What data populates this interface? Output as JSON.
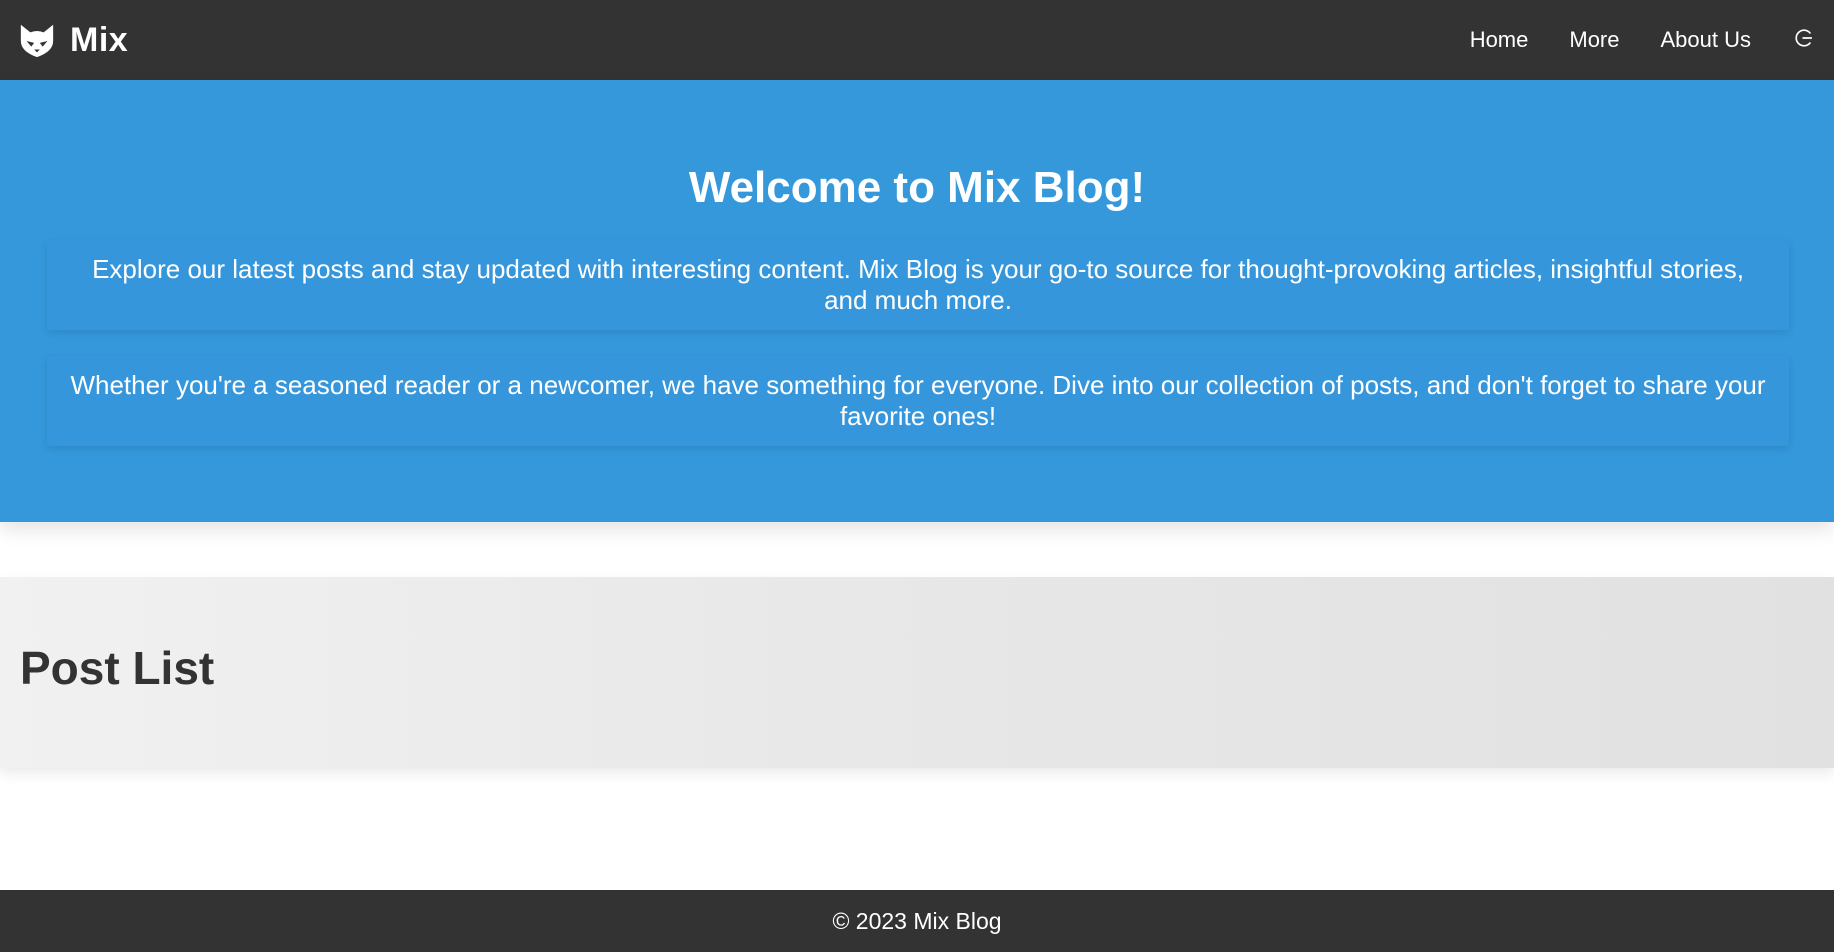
{
  "navbar": {
    "brand_name": "Mix",
    "logo_icon": "fox-icon",
    "links": [
      {
        "label": "Home"
      },
      {
        "label": "More"
      },
      {
        "label": "About Us"
      }
    ],
    "action_icon": "logout-icon"
  },
  "hero": {
    "title": "Welcome to Mix Blog!",
    "paragraphs": [
      "Explore our latest posts and stay updated with interesting content. Mix Blog is your go-to source for thought-provoking articles, insightful stories, and much more.",
      "Whether you're a seasoned reader or a newcomer, we have something for everyone. Dive into our collection of posts, and don't forget to share your favorite ones!"
    ]
  },
  "post_list": {
    "title": "Post List"
  },
  "footer": {
    "text": "© 2023 Mix Blog"
  },
  "colors": {
    "navbar_bg": "#333333",
    "hero_bg": "#3498db",
    "text_light": "#ffffff",
    "text_dark": "#333333",
    "post_list_bg_start": "#f1f1f1",
    "post_list_bg_end": "#e1e1e1"
  }
}
